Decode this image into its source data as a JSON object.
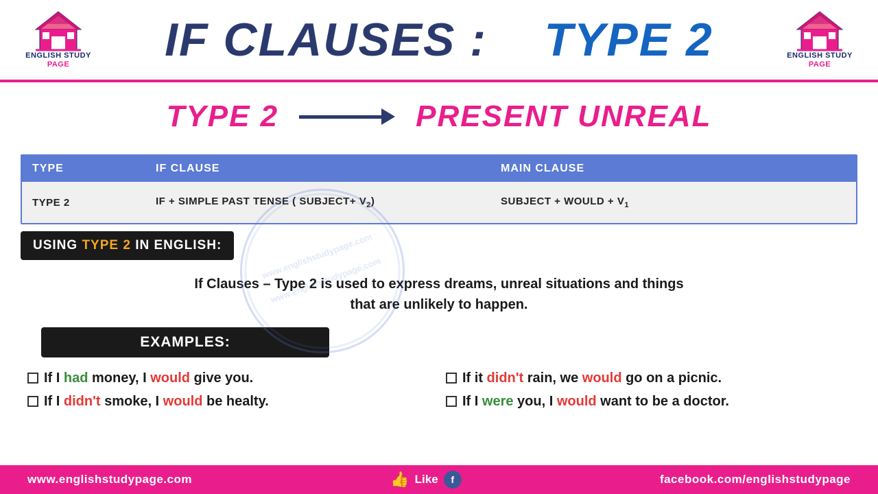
{
  "header": {
    "title_if_clauses": "IF CLAUSES :",
    "title_type2": "TYPE 2",
    "logo_left": {
      "line1": "ENGLISH STUDY",
      "line2": "PAGE"
    },
    "logo_right": {
      "line1": "ENGLISH STUDY",
      "line2": "PAGE"
    }
  },
  "subtitle": {
    "type2_label": "TYPE 2",
    "arrow": "→",
    "description": "PRESENT UNREAL"
  },
  "table": {
    "headers": [
      "TYPE",
      "IF CLAUSE",
      "MAIN CLAUSE"
    ],
    "rows": [
      {
        "type": "TYPE  2",
        "if_clause": "IF + SIMPLE PAST TENSE ( SUBJECT+ V₂)",
        "main_clause": "SUBJECT + WOULD + V₁"
      }
    ]
  },
  "using_section": {
    "label_prefix": "USING ",
    "label_highlight": "TYPE 2",
    "label_suffix": "  IN ENGLISH:"
  },
  "description": "If Clauses – Type 2 is used to express dreams, unreal situations and things that are unlikely to happen.",
  "examples_badge": "EXAMPLES:",
  "examples": [
    {
      "text_parts": [
        "If I ",
        "had",
        " money, I ",
        "would",
        " give you."
      ],
      "colors": [
        "normal",
        "green",
        "normal",
        "red",
        "normal"
      ]
    },
    {
      "text_parts": [
        "If I ",
        "didn't",
        " smoke, I ",
        "would",
        " be healty."
      ],
      "colors": [
        "normal",
        "red",
        "normal",
        "red",
        "normal"
      ]
    },
    {
      "text_parts": [
        "If it ",
        "didn't",
        " rain, we ",
        "would",
        " go on a picnic."
      ],
      "colors": [
        "normal",
        "red",
        "normal",
        "red",
        "normal"
      ]
    },
    {
      "text_parts": [
        "If I ",
        "were",
        " you, I ",
        "would",
        " want to be a doctor."
      ],
      "colors": [
        "normal",
        "green",
        "normal",
        "red",
        "normal"
      ]
    }
  ],
  "footer": {
    "website": "www.englishstudypage.com",
    "like_text": "Like",
    "facebook": "facebook.com/englishstudypage"
  },
  "watermark": "www.englishstudypage.com"
}
